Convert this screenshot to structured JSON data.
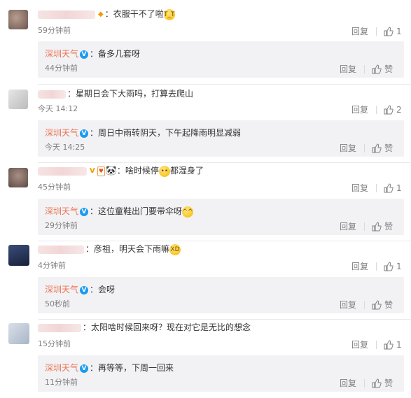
{
  "labels": {
    "reply": "回复",
    "like": "赞"
  },
  "comments": [
    {
      "text": "：衣服干不了啦",
      "time": "59分钟前",
      "likes": "1",
      "reply": {
        "author": "深圳天气",
        "text": "：备多几套呀",
        "time": "44分钟前"
      }
    },
    {
      "text": "：星期日会下大雨吗，打算去爬山",
      "time": "今天 14:12",
      "likes": "2",
      "reply": {
        "author": "深圳天气",
        "text": "：周日中雨转阴天，下午起降雨明显减弱",
        "time": "今天 14:25"
      }
    },
    {
      "text": "：啥时候停",
      "text_after": "都湿身了",
      "time": "45分钟前",
      "likes": "1",
      "reply": {
        "author": "深圳天气",
        "text": "：这位童鞋出门要带伞呀",
        "time": "29分钟前"
      }
    },
    {
      "text": "：彦祖，明天会下雨嘛",
      "time": "4分钟前",
      "likes": "1",
      "reply": {
        "author": "深圳天气",
        "text": "：会呀",
        "time": "50秒前"
      }
    },
    {
      "text": "：太阳啥时候回来呀？现在对它是无比的想念",
      "time": "15分钟前",
      "likes": "1",
      "reply": {
        "author": "深圳天气",
        "text": "：再等等，下周一回来",
        "time": "11分钟前"
      }
    }
  ],
  "colors": {
    "author": "#eb7350",
    "verified": "#1a9bf0",
    "reply_bg": "#f2f2f5",
    "meta": "#808080"
  },
  "icons": [
    "thumbs-up-icon",
    "verified-v-icon",
    "crying-emoji-icon",
    "panda-icon",
    "laughing-emoji-icon"
  ]
}
